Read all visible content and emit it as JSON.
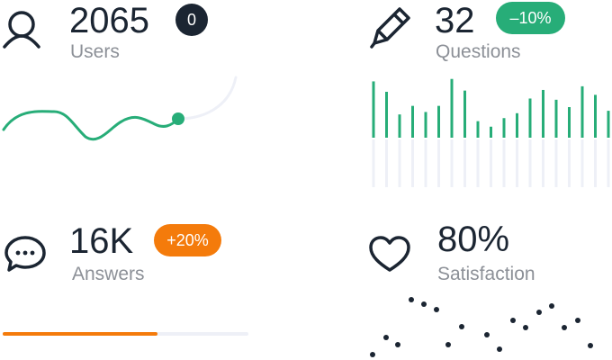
{
  "stats": {
    "users": {
      "value": "2065",
      "label": "Users",
      "badge": "0",
      "badge_color": "#1b2532",
      "icon": "user-icon"
    },
    "questions": {
      "value": "32",
      "label": "Questions",
      "badge": "–10%",
      "badge_color": "#27ad78",
      "icon": "pencil-icon",
      "bars": [
        0.92,
        0.75,
        0.38,
        0.52,
        0.42,
        0.52,
        0.96,
        0.77,
        0.27,
        0.18,
        0.32,
        0.4,
        0.64,
        0.78,
        0.62,
        0.5,
        0.84,
        0.7,
        0.44
      ]
    },
    "answers": {
      "value": "16K",
      "label": "Answers",
      "badge": "+20%",
      "badge_color": "#f47b0b",
      "icon": "chat-bubble-icon",
      "progress": 0.63
    },
    "satisfaction": {
      "value": "80%",
      "label": "Satisfaction",
      "icon": "heart-icon"
    }
  },
  "colors": {
    "accent_green": "#27ad78",
    "accent_orange": "#f47b0b",
    "dark": "#1b2532",
    "muted_text": "#8c9097",
    "track": "#eef0f7"
  }
}
